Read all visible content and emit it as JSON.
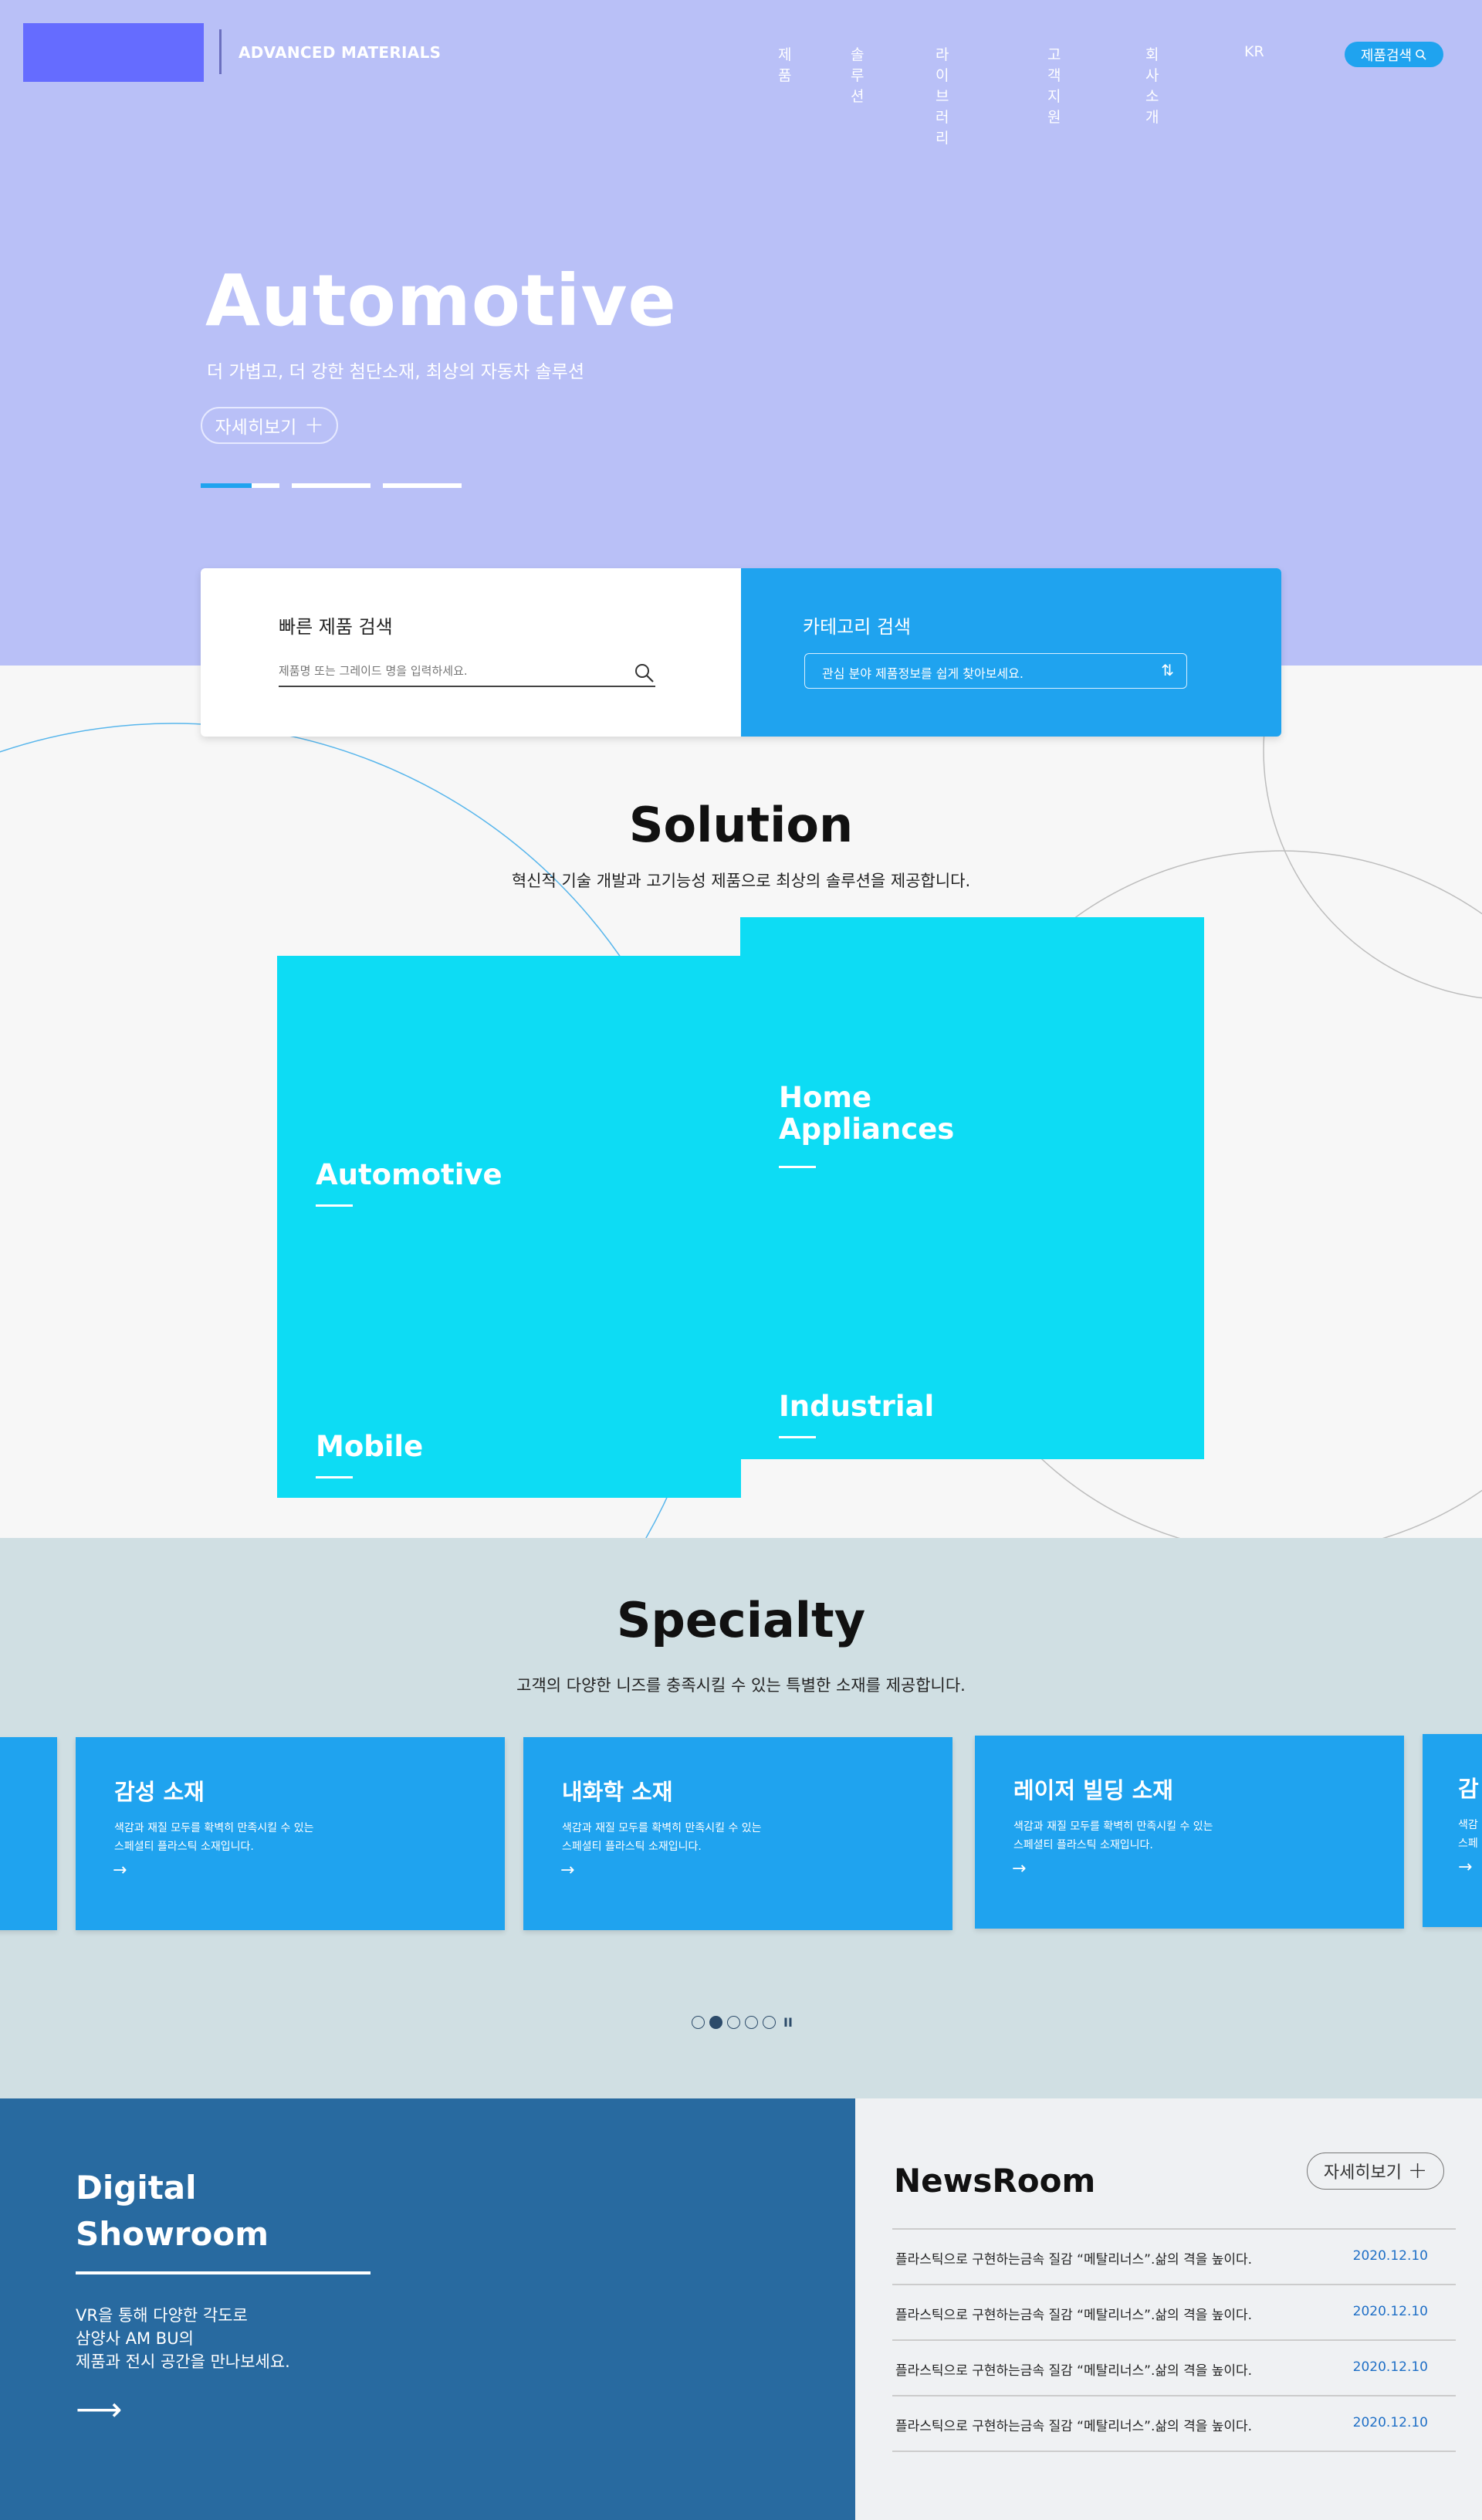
{
  "header": {
    "brand": "ADVANCED MATERIALS",
    "nav": [
      "제품",
      "솔루션",
      "라이브러리",
      "고객지원",
      "회사소개",
      "KR"
    ],
    "search_button": "제품검색"
  },
  "hero": {
    "title": "Automotive",
    "subtitle": "더 가볍고, 더 강한 첨단소재, 최상의 자동차 솔루션",
    "more_label": "자세히보기",
    "slide_count": 3,
    "active_slide": 1,
    "active_slide_progress": 0.65
  },
  "search": {
    "quick_title": "빠른 제품 검색",
    "quick_placeholder": "제품명 또는 그레이드 명을 입력하세요.",
    "category_title": "카테고리 검색",
    "category_select": "관심 분야 제품정보를 쉽게 찾아보세요."
  },
  "solution": {
    "title": "Solution",
    "subtitle": "혁신적 기술 개발과 고기능성 제품으로 최상의 솔루션을 제공합니다.",
    "tiles": [
      "Automotive",
      "Mobile",
      "Home\nAppliances",
      "Industrial"
    ]
  },
  "specialty": {
    "title": "Specialty",
    "subtitle": "고객의 다양한 니즈를 충족시킬 수 있는 특별한 소재를 제공합니다.",
    "cards": [
      {
        "title": "감성 소재",
        "desc": "색감과 재질 모두를 확벽히 만족시킬 수 있는\n스페셜티 플라스틱 소재입니다."
      },
      {
        "title": "내화학 소재",
        "desc": "색감과 재질 모두를 확벽히 만족시킬 수 있는\n스페셜티 플라스틱 소재입니다."
      },
      {
        "title": "레이저 빌딩 소재",
        "desc": "색감과 재질 모두를 확벽히 만족시킬 수 있는\n스페셜티 플라스틱 소재입니다."
      },
      {
        "title": "감",
        "desc": "색감\n스페"
      }
    ],
    "arrow": "→",
    "pagination": {
      "count": 5,
      "active": 2,
      "pause": "II"
    }
  },
  "showroom": {
    "title": "Digital\nShowroom",
    "desc": "VR을 통해 다양한 각도로\n삼양사 AM BU의\n제품과 전시 공간을 만나보세요.",
    "arrow": "⟶"
  },
  "news": {
    "title": "NewsRoom",
    "more_label": "자세히보기",
    "items": [
      {
        "title": "플라스틱으로 구현하는금속 질감 “메탈리너스”.삶의 격을 높이다.",
        "date": "2020.12.10"
      },
      {
        "title": "플라스틱으로 구현하는금속 질감 “메탈리너스”.삶의 격을 높이다.",
        "date": "2020.12.10"
      },
      {
        "title": "플라스틱으로 구현하는금속 질감 “메탈리너스”.삶의 격을 높이다.",
        "date": "2020.12.10"
      },
      {
        "title": "플라스틱으로 구현하는금속 질감 “메탈리너스”.삶의 격을 높이다.",
        "date": "2020.12.10"
      }
    ]
  },
  "colors": {
    "hero_bg": "#b9c0f7",
    "logo": "#656cff",
    "accent_blue": "#1fa3ef",
    "tile_cyan": "#0ddcf4",
    "specialty_bg": "#d0dfe3",
    "showroom_bg": "#286aa0",
    "news_date": "#1f6fc6"
  }
}
